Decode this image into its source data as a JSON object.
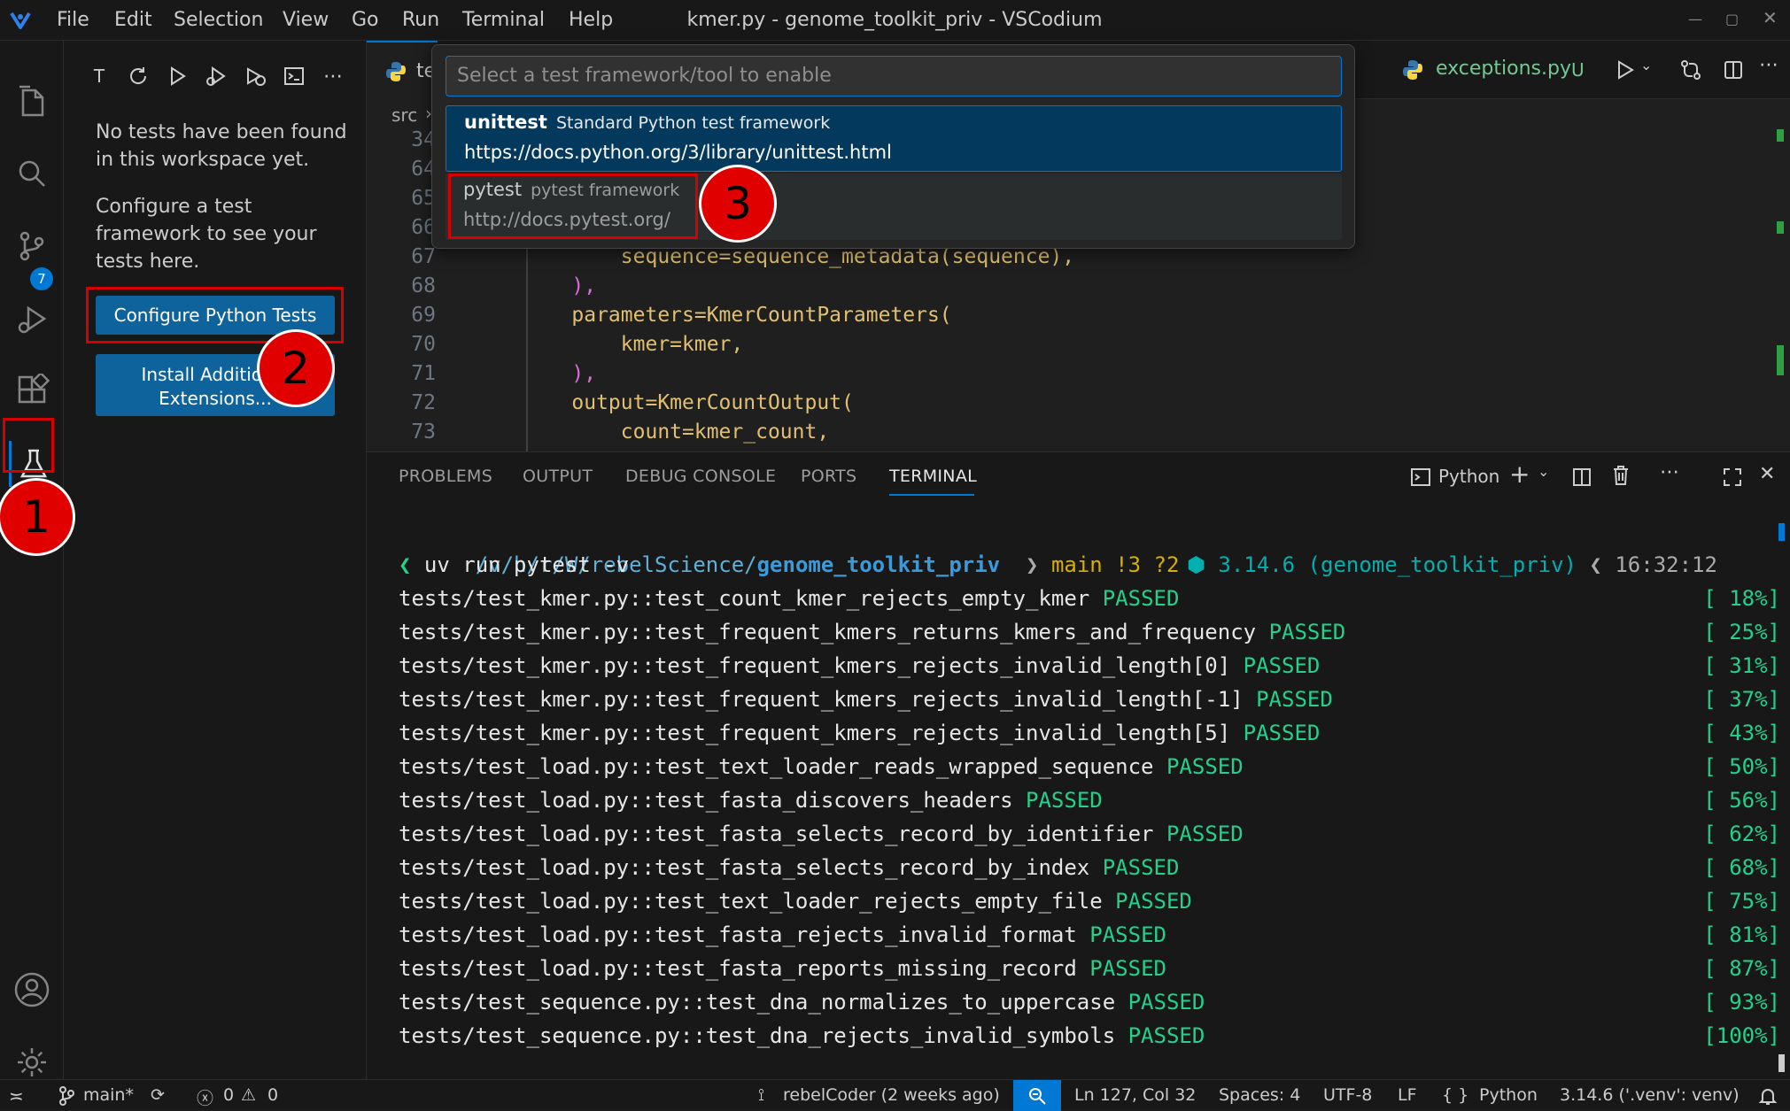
{
  "titlebar": {
    "menu": [
      "File",
      "Edit",
      "Selection",
      "View",
      "Go",
      "Run",
      "Terminal",
      "Help"
    ],
    "title": "kmer.py - genome_toolkit_priv - VSCodium"
  },
  "activity_bar": {
    "scm_badge": "7"
  },
  "sidebar": {
    "toolbar_letter": "T",
    "message1": "No tests have been found in this workspace yet.",
    "message2": "Configure a test framework to see your tests here.",
    "configure_button": "Configure Python Tests",
    "install_button": "Install Additional Extensions..."
  },
  "editor": {
    "tab_partial": "te",
    "tab_right": "exceptions.py",
    "tab_right_status": "U",
    "breadcrumb": "src",
    "lines": [
      {
        "n": "34",
        "code": ""
      },
      {
        "n": "64",
        "code": ""
      },
      {
        "n": "65",
        "code": ""
      },
      {
        "n": "66",
        "code": ""
      },
      {
        "n": "67",
        "code": "        sequence=sequence_metadata(sequence),"
      },
      {
        "n": "68",
        "code": "    ),"
      },
      {
        "n": "69",
        "code": "    parameters=KmerCountParameters("
      },
      {
        "n": "70",
        "code": "        kmer=kmer,"
      },
      {
        "n": "71",
        "code": "    ),"
      },
      {
        "n": "72",
        "code": "    output=KmerCountOutput("
      },
      {
        "n": "73",
        "code": "        count=kmer_count,"
      }
    ]
  },
  "quick_pick": {
    "placeholder": "Select a test framework/tool to enable",
    "items": [
      {
        "name": "unittest",
        "desc": "Standard Python test framework",
        "url": "https://docs.python.org/3/library/unittest.html"
      },
      {
        "name": "pytest",
        "desc": "pytest framework",
        "url": "http://docs.pytest.org/"
      }
    ]
  },
  "panel": {
    "tabs": [
      "PROBLEMS",
      "OUTPUT",
      "DEBUG CONSOLE",
      "PORTS",
      "TERMINAL"
    ],
    "terminal_profile": "Python",
    "prompt": {
      "path_dim": "/v/h/r/W/rebelScience/",
      "path_bold": "genome_toolkit_priv",
      "branch": "main !3 ?2",
      "python": "3.14.6 (genome_toolkit_priv)",
      "time": "16:32:12"
    },
    "command": "uv run pytest -v",
    "results": [
      {
        "test": "tests/test_kmer.py::test_count_kmer_rejects_empty_kmer",
        "status": "PASSED",
        "pct": "[ 18%]"
      },
      {
        "test": "tests/test_kmer.py::test_frequent_kmers_returns_kmers_and_frequency",
        "status": "PASSED",
        "pct": "[ 25%]"
      },
      {
        "test": "tests/test_kmer.py::test_frequent_kmers_rejects_invalid_length[0]",
        "status": "PASSED",
        "pct": "[ 31%]"
      },
      {
        "test": "tests/test_kmer.py::test_frequent_kmers_rejects_invalid_length[-1]",
        "status": "PASSED",
        "pct": "[ 37%]"
      },
      {
        "test": "tests/test_kmer.py::test_frequent_kmers_rejects_invalid_length[5]",
        "status": "PASSED",
        "pct": "[ 43%]"
      },
      {
        "test": "tests/test_load.py::test_text_loader_reads_wrapped_sequence",
        "status": "PASSED",
        "pct": "[ 50%]"
      },
      {
        "test": "tests/test_load.py::test_fasta_discovers_headers",
        "status": "PASSED",
        "pct": "[ 56%]"
      },
      {
        "test": "tests/test_load.py::test_fasta_selects_record_by_identifier",
        "status": "PASSED",
        "pct": "[ 62%]"
      },
      {
        "test": "tests/test_load.py::test_fasta_selects_record_by_index",
        "status": "PASSED",
        "pct": "[ 68%]"
      },
      {
        "test": "tests/test_load.py::test_text_loader_rejects_empty_file",
        "status": "PASSED",
        "pct": "[ 75%]"
      },
      {
        "test": "tests/test_load.py::test_fasta_rejects_invalid_format",
        "status": "PASSED",
        "pct": "[ 81%]"
      },
      {
        "test": "tests/test_load.py::test_fasta_reports_missing_record",
        "status": "PASSED",
        "pct": "[ 87%]"
      },
      {
        "test": "tests/test_sequence.py::test_dna_normalizes_to_uppercase",
        "status": "PASSED",
        "pct": "[ 93%]"
      },
      {
        "test": "tests/test_sequence.py::test_dna_rejects_invalid_symbols",
        "status": "PASSED",
        "pct": "[100%]"
      }
    ]
  },
  "statusbar": {
    "branch": "main*",
    "errors": "0",
    "warnings": "0",
    "blame": "rebelCoder (2 weeks ago)",
    "position": "Ln 127, Col 32",
    "spaces": "Spaces: 4",
    "encoding": "UTF-8",
    "eol": "LF",
    "language": "Python",
    "interpreter": "3.14.6 ('.venv': venv)"
  },
  "annotations": [
    "1",
    "2",
    "3"
  ],
  "colors": {
    "accent": "#0e639c",
    "selection": "#04395e",
    "pass": "#23d18b",
    "marker": "#d70000"
  }
}
